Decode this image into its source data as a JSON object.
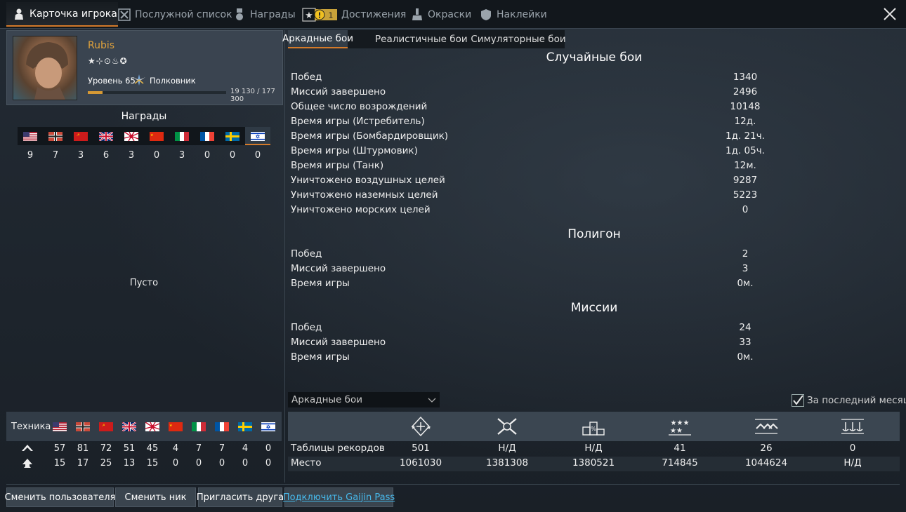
{
  "top_tabs": [
    {
      "label": "Карточка игрока",
      "icon": "player-card-icon"
    },
    {
      "label": "Послужной список",
      "icon": "service-record-icon"
    },
    {
      "label": "Награды",
      "icon": "medal-icon"
    },
    {
      "label": "Достижения",
      "icon": "achievements-icon",
      "badge": "1"
    },
    {
      "label": "Окраски",
      "icon": "paint-icon"
    },
    {
      "label": "Наклейки",
      "icon": "decal-icon"
    }
  ],
  "profile": {
    "name": "Rubis",
    "title": "★⊹⊙♨✪",
    "level_label": "Уровень 65",
    "rank": "Полковник",
    "xp_text": "19 130 / 177 300",
    "xp_fraction": 0.108
  },
  "awards": {
    "title": "Награды",
    "nations": [
      "usa",
      "germany",
      "ussr",
      "britain",
      "japan",
      "china",
      "italy",
      "france",
      "sweden",
      "israel"
    ],
    "counts": [
      "9",
      "7",
      "3",
      "6",
      "3",
      "0",
      "3",
      "0",
      "0",
      "0"
    ],
    "empty_text": "Пусто"
  },
  "tech": {
    "label": "Техника",
    "row1": [
      "57",
      "81",
      "72",
      "51",
      "45",
      "4",
      "7",
      "7",
      "4",
      "0"
    ],
    "row2": [
      "15",
      "17",
      "25",
      "13",
      "15",
      "0",
      "0",
      "0",
      "0",
      "0"
    ]
  },
  "buttons": {
    "change_user": "Сменить пользователя",
    "change_nick": "Сменить ник",
    "invite_friend": "Пригласить друга",
    "gaijin_pass": "Подключить Gaijin Pass"
  },
  "mode_tabs": [
    "Аркадные бои",
    "Реалистичные бои",
    "Симуляторные бои"
  ],
  "sections": [
    {
      "title": "Случайные бои",
      "rows": [
        {
          "label": "Побед",
          "value": "1340"
        },
        {
          "label": "Миссий завершено",
          "value": "2496"
        },
        {
          "label": "Общее число возрождений",
          "value": "10148"
        },
        {
          "label": "Время игры (Истребитель)",
          "value": "12д."
        },
        {
          "label": "Время игры (Бомбардировщик)",
          "value": "1д. 21ч."
        },
        {
          "label": "Время игры (Штурмовик)",
          "value": "1д. 05ч."
        },
        {
          "label": "Время игры (Танк)",
          "value": "12м."
        },
        {
          "label": "Уничтожено воздушных целей",
          "value": "9287"
        },
        {
          "label": "Уничтожено наземных целей",
          "value": "5223"
        },
        {
          "label": "Уничтожено морских целей",
          "value": "0"
        }
      ]
    },
    {
      "title": "Полигон",
      "rows": [
        {
          "label": "Побед",
          "value": "2"
        },
        {
          "label": "Миссий завершено",
          "value": "3"
        },
        {
          "label": "Время игры",
          "value": "0м."
        }
      ]
    },
    {
      "title": "Миссии",
      "rows": [
        {
          "label": "Побед",
          "value": "24"
        },
        {
          "label": "Миссий завершено",
          "value": "33"
        },
        {
          "label": "Время игры",
          "value": "0м."
        }
      ]
    }
  ],
  "records": {
    "dropdown_value": "Аркадные бои",
    "last_month_label": "За последний месяц",
    "last_month_checked": true,
    "icons": [
      "leaderboard-ace-icon",
      "crossed-swords-icon",
      "podium-percent-icon",
      "stars-icon",
      "aircraft-formation-icon",
      "naval-anchors-icon"
    ],
    "rows": [
      {
        "label": "Таблицы рекордов",
        "values": [
          "501",
          "Н/Д",
          "Н/Д",
          "41",
          "26",
          "0"
        ]
      },
      {
        "label": "Место",
        "values": [
          "1061030",
          "1381308",
          "1380521",
          "714845",
          "1044624",
          "Н/Д"
        ]
      }
    ]
  }
}
